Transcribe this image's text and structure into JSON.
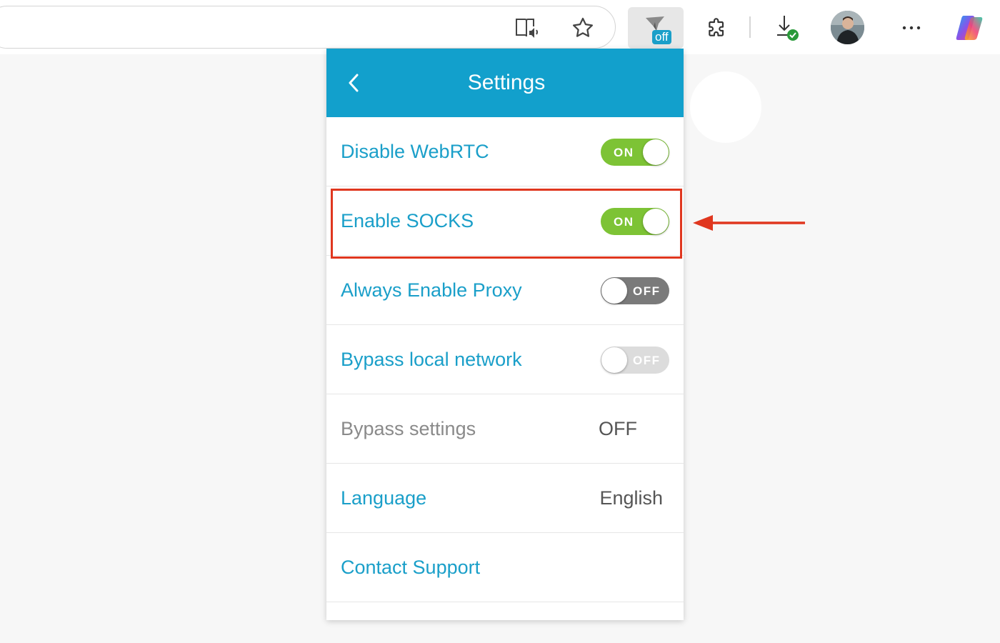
{
  "toolbar": {
    "icons": [
      "immersive-reader-icon",
      "favorite-star-icon",
      "proxy-extension-icon",
      "extensions-puzzle-icon",
      "downloads-icon",
      "profile-avatar",
      "more-options-icon",
      "copilot-icon"
    ],
    "extension_badge": "off"
  },
  "popup": {
    "title": "Settings",
    "rows": [
      {
        "label": "Disable WebRTC",
        "type": "toggle",
        "state": "ON"
      },
      {
        "label": "Enable SOCKS",
        "type": "toggle",
        "state": "ON",
        "highlighted": true
      },
      {
        "label": "Always Enable Proxy",
        "type": "toggle",
        "state": "OFF"
      },
      {
        "label": "Bypass local network",
        "type": "toggle",
        "state": "OFF"
      },
      {
        "label": "Bypass settings",
        "type": "value",
        "value": "OFF"
      },
      {
        "label": "Language",
        "type": "value",
        "value": "English"
      },
      {
        "label": "Contact Support",
        "type": "link"
      }
    ]
  },
  "colors": {
    "header": "#12a0cc",
    "label": "#1a9fc9",
    "toggle_on": "#7dc335",
    "toggle_off": "#7a7a7a",
    "annotation": "#e0371f"
  }
}
